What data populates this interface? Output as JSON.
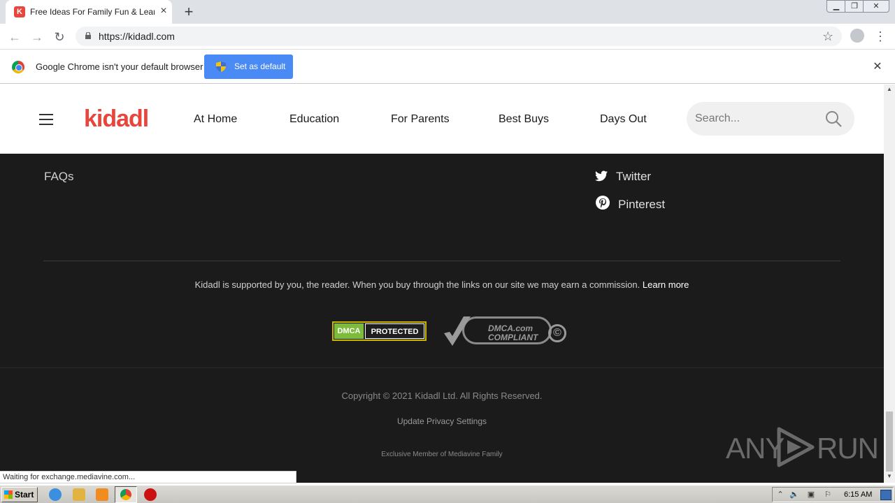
{
  "browser": {
    "tab_title": "Free Ideas For Family Fun & Learning",
    "tab_favicon_letter": "K",
    "url": "https://kidadl.com",
    "new_tab_glyph": "+",
    "infobar": {
      "message": "Google Chrome isn't your default browser",
      "button_label": "Set as default"
    },
    "status_text": "Waiting for exchange.mediavine.com..."
  },
  "site": {
    "logo": "kidadl",
    "nav": [
      "At Home",
      "Education",
      "For Parents",
      "Best Buys",
      "Days Out"
    ],
    "search_placeholder": "Search...",
    "footer": {
      "faqs": "FAQs",
      "social": [
        "Twitter",
        "Pinterest"
      ],
      "disclosure": "Kidadl is supported by you, the reader. When you buy through the links on our site we may earn a commission.",
      "disclosure_link": "Learn more",
      "dmca_protected_left": "DMCA",
      "dmca_protected_right": "PROTECTED",
      "dmca_compliant_line1": "DMCA.com",
      "dmca_compliant_line2": "COMPLIANT",
      "dmca_copyright_glyph": "©",
      "copyright": "Copyright © 2021 Kidadl Ltd. All Rights Reserved.",
      "privacy": "Update Privacy Settings",
      "mediavine": "Exclusive Member of Mediavine Family"
    }
  },
  "watermark": {
    "left": "ANY",
    "right": "RUN"
  },
  "taskbar": {
    "start_label": "Start",
    "clock": "6:15 AM"
  },
  "colors": {
    "brand_red": "#e8453c",
    "chrome_blue_button": "#4a8af4",
    "footer_bg": "#1b1b1b"
  }
}
